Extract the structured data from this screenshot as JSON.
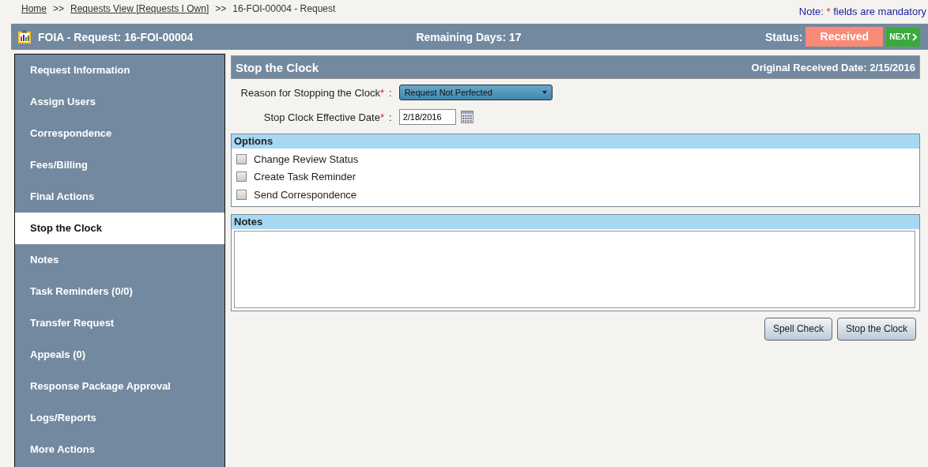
{
  "breadcrumb": [
    {
      "label": "Home",
      "link": true
    },
    {
      "label": ">>",
      "link": false
    },
    {
      "label": "Requests View [Requests I Own]",
      "link": true
    },
    {
      "label": ">>",
      "link": false
    },
    {
      "label": "16-FOI-00004 - Request",
      "link": false
    }
  ],
  "note": {
    "prefix": "Note:",
    "mark": "*",
    "suffix": "fields are mandatory"
  },
  "header": {
    "title": "FOIA - Request: 16-FOI-00004",
    "remaining": "Remaining Days: 17",
    "status_label": "Status:",
    "status": "Received",
    "next": "NEXT"
  },
  "sidebar": {
    "items": [
      {
        "label": "Request Information",
        "selected": false
      },
      {
        "label": "Assign Users",
        "selected": false
      },
      {
        "label": "Correspondence",
        "selected": false
      },
      {
        "label": "Fees/Billing",
        "selected": false
      },
      {
        "label": "Final Actions",
        "selected": false
      },
      {
        "label": "Stop the Clock",
        "selected": true
      },
      {
        "label": "Notes",
        "selected": false
      },
      {
        "label": "Task Reminders (0/0)",
        "selected": false
      },
      {
        "label": "Transfer Request",
        "selected": false
      },
      {
        "label": "Appeals (0)",
        "selected": false
      },
      {
        "label": "Response Package Approval",
        "selected": false
      },
      {
        "label": "Logs/Reports",
        "selected": false
      },
      {
        "label": "More Actions",
        "selected": false
      }
    ]
  },
  "panel": {
    "title": "Stop the Clock",
    "received": "Original Received Date: 2/15/2016",
    "fields": [
      {
        "kind": "dropdown",
        "label": "Reason for Stopping the Clock",
        "required": true,
        "separator": ":",
        "value": "Request Not Perfected"
      },
      {
        "kind": "date",
        "label": "Stop Clock Effective Date",
        "required": true,
        "separator": ":",
        "value": "2/18/2016"
      }
    ],
    "options": {
      "title": "Options",
      "items": [
        {
          "label": "Change Review Status",
          "checked": false
        },
        {
          "label": "Create Task Reminder",
          "checked": false
        },
        {
          "label": "Send Correspondence",
          "checked": false
        }
      ]
    },
    "notes": {
      "title": "Notes"
    },
    "buttons": [
      "Spell Check",
      "Stop the Clock"
    ]
  }
}
